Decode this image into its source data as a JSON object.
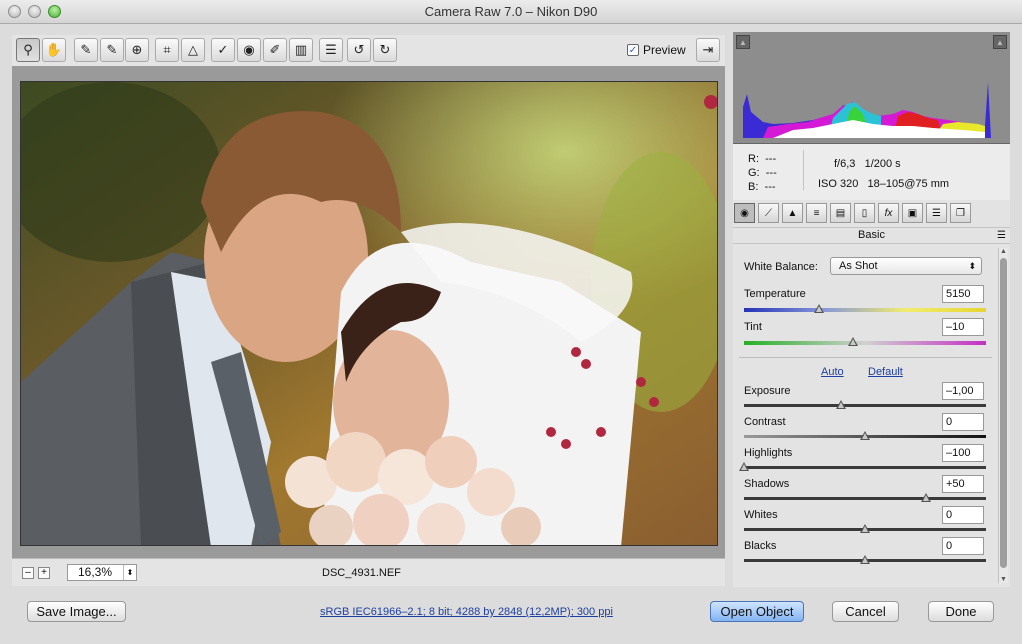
{
  "window": {
    "title": "Camera Raw 7.0  –  Nikon D90"
  },
  "toolbar": {
    "tools": [
      {
        "name": "zoom-tool",
        "glyph": "⚲",
        "active": true
      },
      {
        "name": "hand-tool",
        "glyph": "✋"
      },
      {
        "name": "white-balance-tool",
        "glyph": "✎"
      },
      {
        "name": "color-sampler-tool",
        "glyph": "✎"
      },
      {
        "name": "targeted-adjustment-tool",
        "glyph": "⊕"
      },
      {
        "name": "crop-tool",
        "glyph": "⌗"
      },
      {
        "name": "straighten-tool",
        "glyph": "△"
      },
      {
        "name": "spot-removal-tool",
        "glyph": "✓"
      },
      {
        "name": "red-eye-removal-tool",
        "glyph": "◉"
      },
      {
        "name": "adjustment-brush-tool",
        "glyph": "✐"
      },
      {
        "name": "graduated-filter-tool",
        "glyph": "▥"
      },
      {
        "name": "preferences-tool",
        "glyph": "☰"
      },
      {
        "name": "rotate-left-tool",
        "glyph": "↺"
      },
      {
        "name": "rotate-right-tool",
        "glyph": "↻"
      }
    ],
    "preview_label": "Preview",
    "preview_checked": true
  },
  "status": {
    "zoom": "16,3%",
    "filename": "DSC_4931.NEF"
  },
  "info": {
    "r_label": "R:",
    "g_label": "G:",
    "b_label": "B:",
    "r_value": "---",
    "g_value": "---",
    "b_value": "---",
    "aperture": "f/6,3",
    "shutter": "1/200 s",
    "iso": "ISO 320",
    "lens": "18–105@75 mm"
  },
  "panel": {
    "title": "Basic",
    "white_balance_label": "White Balance:",
    "white_balance_value": "As Shot",
    "auto_label": "Auto",
    "default_label": "Default"
  },
  "sliders": {
    "temperature": {
      "label": "Temperature",
      "value": "5150",
      "position": 0.31
    },
    "tint": {
      "label": "Tint",
      "value": "–10",
      "position": 0.45
    },
    "exposure": {
      "label": "Exposure",
      "value": "–1,00",
      "position": 0.4
    },
    "contrast": {
      "label": "Contrast",
      "value": "0",
      "position": 0.5
    },
    "highlights": {
      "label": "Highlights",
      "value": "–100",
      "position": 0.0
    },
    "shadows": {
      "label": "Shadows",
      "value": "+50",
      "position": 0.75
    },
    "whites": {
      "label": "Whites",
      "value": "0",
      "position": 0.5
    },
    "blacks": {
      "label": "Blacks",
      "value": "0",
      "position": 0.5
    }
  },
  "footer": {
    "save_label": "Save Image...",
    "workflow_link": "sRGB IEC61966–2.1; 8 bit; 4288 by 2848 (12,2MP); 300 ppi",
    "open_label": "Open Object",
    "cancel_label": "Cancel",
    "done_label": "Done"
  }
}
